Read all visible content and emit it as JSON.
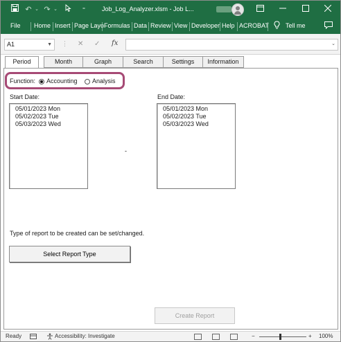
{
  "titlebar": {
    "save_icon": "save-icon",
    "undo_icon": "undo-icon",
    "redo_icon": "redo-icon",
    "pointer_icon": "pointer-icon",
    "title": "Job_Log_Analyzer.xlsm  -  Job L...",
    "minimize_icon": "minimize-icon",
    "restore_icon": "restore-icon",
    "close_icon": "close-icon"
  },
  "ribbon": {
    "tabs": [
      "File",
      "Home",
      "Insert",
      "Page Layo",
      "Formulas",
      "Data",
      "Review",
      "View",
      "Developer",
      "Help",
      "ACROBAT"
    ],
    "tell_me": "Tell me"
  },
  "formula_bar": {
    "name_box": "A1",
    "fx": "fx",
    "value": ""
  },
  "form": {
    "tabs": [
      "Period",
      "Month",
      "Graph",
      "Search",
      "Settings",
      "Information"
    ],
    "active_tab": "Period",
    "function_label": "Function:",
    "function_options": [
      "Accounting",
      "Analysis"
    ],
    "function_selected": "Accounting",
    "start_label": "Start Date:",
    "end_label": "End Date:",
    "start_dates": [
      "05/01/2023 Mon",
      "05/02/2023 Tue",
      "05/03/2023 Wed"
    ],
    "end_dates": [
      "05/01/2023 Mon",
      "05/02/2023 Tue",
      "05/03/2023 Wed"
    ],
    "separator": "-",
    "hint": "Type of report to be created can be set/changed.",
    "select_report_btn": "Select Report Type",
    "create_report_btn": "Create Report"
  },
  "status": {
    "ready": "Ready",
    "accessibility": "Accessibility: Investigate",
    "zoom": "100%",
    "zoom_out": "−",
    "zoom_in": "+"
  },
  "colors": {
    "excel_green": "#1f6e43",
    "highlight": "#a64a75"
  }
}
